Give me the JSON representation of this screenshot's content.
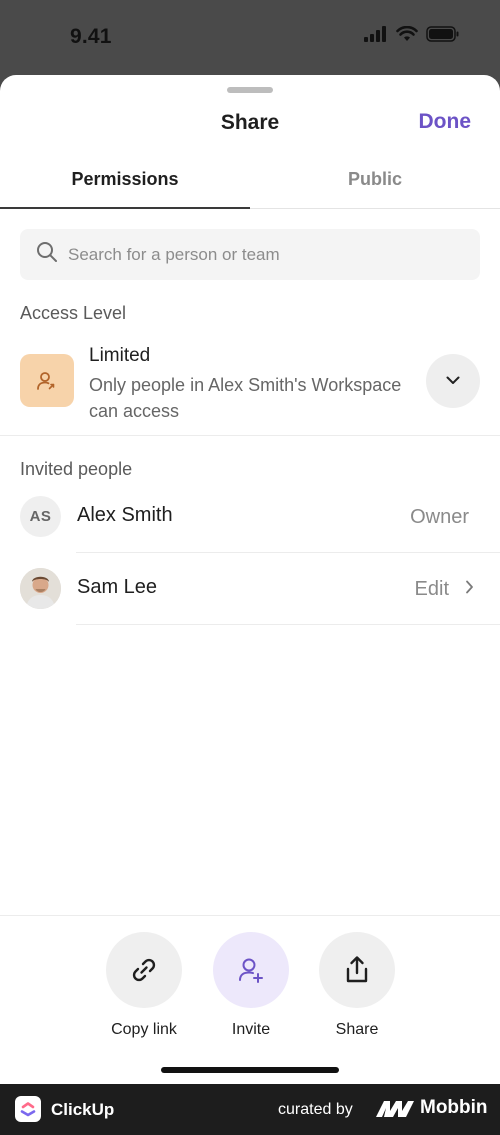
{
  "status_bar": {
    "time": "9.41"
  },
  "sheet": {
    "title": "Share",
    "done_label": "Done"
  },
  "tabs": [
    {
      "label": "Permissions",
      "selected": true
    },
    {
      "label": "Public",
      "selected": false
    }
  ],
  "search": {
    "placeholder": "Search for a person or team",
    "value": ""
  },
  "access": {
    "section_label": "Access Level",
    "title": "Limited",
    "description": "Only people in Alex Smith's Workspace can access",
    "icon": "person-lock-icon"
  },
  "invited": {
    "section_label": "Invited people",
    "people": [
      {
        "initials": "AS",
        "name": "Alex Smith",
        "role": "Owner"
      },
      {
        "name": "Sam Lee",
        "role": "Edit"
      }
    ]
  },
  "actions": [
    {
      "label": "Copy link",
      "icon": "link-icon"
    },
    {
      "label": "Invite",
      "icon": "add-person-icon"
    },
    {
      "label": "Share",
      "icon": "share-icon"
    }
  ],
  "footer": {
    "app_name": "ClickUp",
    "curated_by": "curated by",
    "brand": "Mobbin"
  },
  "colors": {
    "accent": "#6c53c6",
    "invite_bg": "#ede8fb",
    "access_icon_bg": "#f7d3aa"
  }
}
